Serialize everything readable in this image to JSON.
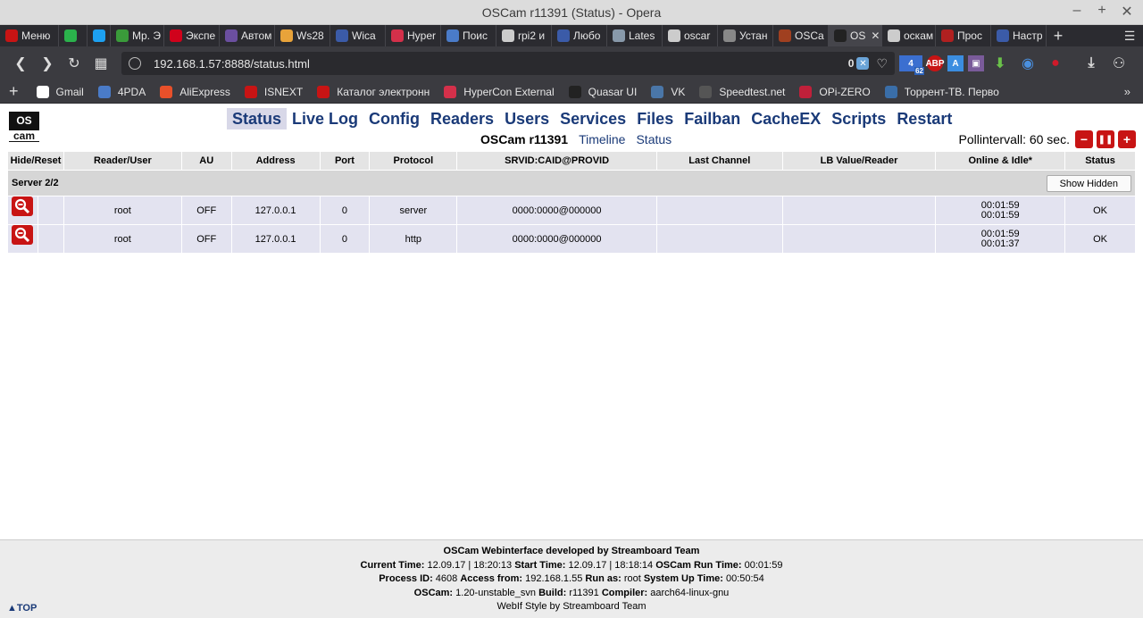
{
  "window": {
    "title": "OSCam r11391 (Status) - Opera"
  },
  "tabs": [
    {
      "label": "Меню",
      "color": "#c81414"
    },
    {
      "label": "",
      "color": "#2bb24c"
    },
    {
      "label": "",
      "color": "#1da1f2"
    },
    {
      "label": "Mp. Э",
      "color": "#3a9b3a"
    },
    {
      "label": "Экспе",
      "color": "#d0021b"
    },
    {
      "label": "Автом",
      "color": "#6b4fa0"
    },
    {
      "label": "Ws28",
      "color": "#e8a33a"
    },
    {
      "label": "Wica",
      "color": "#3b5ba8"
    },
    {
      "label": "Hyper",
      "color": "#d4304a"
    },
    {
      "label": "Поис",
      "color": "#4a7bc8"
    },
    {
      "label": "rpi2 и",
      "color": "#cccccc"
    },
    {
      "label": "Любо",
      "color": "#3b5ba8"
    },
    {
      "label": "Lates",
      "color": "#8899aa"
    },
    {
      "label": "oscar",
      "color": "#cccccc"
    },
    {
      "label": "Устан",
      "color": "#888888"
    },
    {
      "label": "OSCa",
      "color": "#a04020"
    },
    {
      "label": "OS",
      "color": "#222222",
      "active": true
    },
    {
      "label": "оскам",
      "color": "#cccccc"
    },
    {
      "label": "Прос",
      "color": "#b02020"
    },
    {
      "label": "Настр",
      "color": "#3b5ba8"
    }
  ],
  "address": {
    "url": "192.168.1.57:8888/status.html",
    "counter": "0",
    "ext_badge": "62"
  },
  "bookmarks": [
    {
      "label": "Gmail",
      "color": "#ffffff"
    },
    {
      "label": "4PDA",
      "color": "#4a7bc8"
    },
    {
      "label": "AliExpress",
      "color": "#e8502a"
    },
    {
      "label": "ISNEXT",
      "color": "#c81414"
    },
    {
      "label": "Каталог электронн",
      "color": "#c81414"
    },
    {
      "label": "HyperCon External",
      "color": "#d4304a"
    },
    {
      "label": "Quasar UI",
      "color": "#222222"
    },
    {
      "label": "VK",
      "color": "#4a76a8"
    },
    {
      "label": "Speedtest.net",
      "color": "#555555"
    },
    {
      "label": "OPi-ZERO",
      "color": "#c0203a"
    },
    {
      "label": "Торрент-ТВ. Перво",
      "color": "#3a6ea8"
    }
  ],
  "logo": {
    "line1": "OS",
    "line2": "cam"
  },
  "menu": [
    "Status",
    "Live Log",
    "Config",
    "Readers",
    "Users",
    "Services",
    "Files",
    "Failban",
    "CacheEX",
    "Scripts",
    "Restart"
  ],
  "submenu": {
    "version": "OSCam r11391",
    "links": [
      "Timeline",
      "Status"
    ]
  },
  "poll": {
    "label": "Pollintervall: 60 sec.",
    "minus": "−",
    "pause": "❚❚",
    "plus": "+"
  },
  "table": {
    "headers": [
      "Hide/Reset",
      "Reader/User",
      "AU",
      "Address",
      "Port",
      "Protocol",
      "SRVID:CAID@PROVID",
      "Last Channel",
      "LB Value/Reader",
      "Online & Idle*",
      "Status"
    ],
    "group_label": "Server 2/2",
    "show_hidden": "Show Hidden",
    "rows": [
      {
        "user": "root",
        "au": "OFF",
        "address": "127.0.0.1",
        "port": "0",
        "protocol": "server",
        "srvid": "0000:0000@000000",
        "last_channel": "",
        "lb": "",
        "online": "00:01:59",
        "idle": "00:01:59",
        "status": "OK"
      },
      {
        "user": "root",
        "au": "OFF",
        "address": "127.0.0.1",
        "port": "0",
        "protocol": "http",
        "srvid": "0000:0000@000000",
        "last_channel": "",
        "lb": "",
        "online": "00:01:59",
        "idle": "00:01:37",
        "status": "OK"
      }
    ]
  },
  "footer": {
    "line1": "OSCam Webinterface developed by Streamboard Team",
    "current_time_label": "Current Time:",
    "current_time": "12.09.17 | 18:20:13",
    "start_time_label": "Start Time:",
    "start_time": "12.09.17 | 18:18:14",
    "run_time_label": "OSCam Run Time:",
    "run_time": "00:01:59",
    "pid_label": "Process ID:",
    "pid": "4608",
    "access_label": "Access from:",
    "access": "192.168.1.55",
    "runas_label": "Run as:",
    "runas": "root",
    "uptime_label": "System Up Time:",
    "uptime": "00:50:54",
    "oscam_label": "OSCam:",
    "oscam": "1.20-unstable_svn",
    "build_label": "Build:",
    "build": "r11391",
    "compiler_label": "Compiler:",
    "compiler": "aarch64-linux-gnu",
    "style": "WebIf Style by Streamboard Team",
    "top": "▲TOP"
  },
  "colors": {
    "menu_link": "#1a3a78",
    "accent_red": "#c81414",
    "row_bg": "#e3e3f0"
  }
}
